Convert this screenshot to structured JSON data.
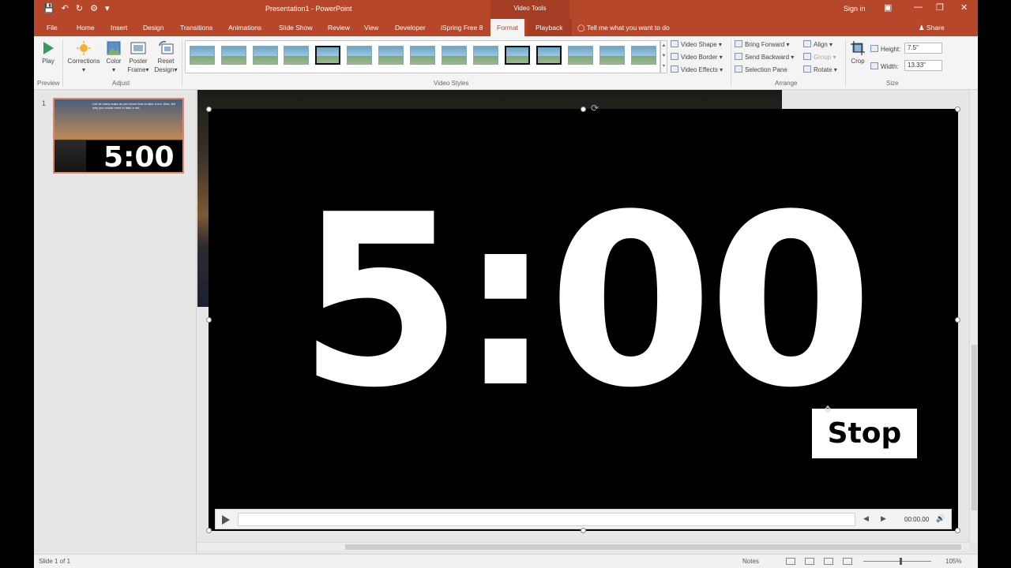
{
  "window": {
    "title": "Presentation1 - PowerPoint",
    "context_group": "Video Tools",
    "sign_in": "Sign in"
  },
  "tabs": {
    "file": "File",
    "home": "Home",
    "insert": "Insert",
    "design": "Design",
    "transitions": "Transitions",
    "animations": "Animations",
    "slide_show": "Slide Show",
    "review": "Review",
    "view": "View",
    "developer": "Developer",
    "ispring": "iSpring Free 8",
    "format": "Format",
    "playback": "Playback",
    "tell_me": "Tell me what you want to do",
    "share": "Share"
  },
  "ribbon": {
    "preview": {
      "play": "Play",
      "group": "Preview"
    },
    "adjust": {
      "corrections": "Corrections",
      "color": "Color",
      "poster_frame_1": "Poster",
      "poster_frame_2": "Frame",
      "reset_design_1": "Reset",
      "reset_design_2": "Design",
      "group": "Adjust"
    },
    "video_styles": {
      "video_shape": "Video Shape",
      "video_border": "Video Border",
      "video_effects": "Video Effects",
      "group": "Video Styles"
    },
    "arrange": {
      "bring_forward": "Bring Forward",
      "send_backward": "Send Backward",
      "selection_pane": "Selection Pane",
      "align": "Align",
      "group_cmd": "Group",
      "rotate": "Rotate",
      "group": "Arrange"
    },
    "size": {
      "crop": "Crop",
      "height_label": "Height:",
      "height_value": "7.5\"",
      "width_label": "Width:",
      "width_value": "13.33\"",
      "group": "Size"
    }
  },
  "slides_pane": {
    "slide_number": "1",
    "thumb_text": "List as many ways as you know how to take a nut. Also, tell why you would need to take a nut.",
    "thumb_timer": "5:00"
  },
  "slide": {
    "timer": "5:00",
    "stop_label": "Stop"
  },
  "media_controls": {
    "time": "00:00.00"
  },
  "status_bar": {
    "slide_info": "Slide 1 of 1",
    "notes": "Notes",
    "zoom": "105%"
  }
}
